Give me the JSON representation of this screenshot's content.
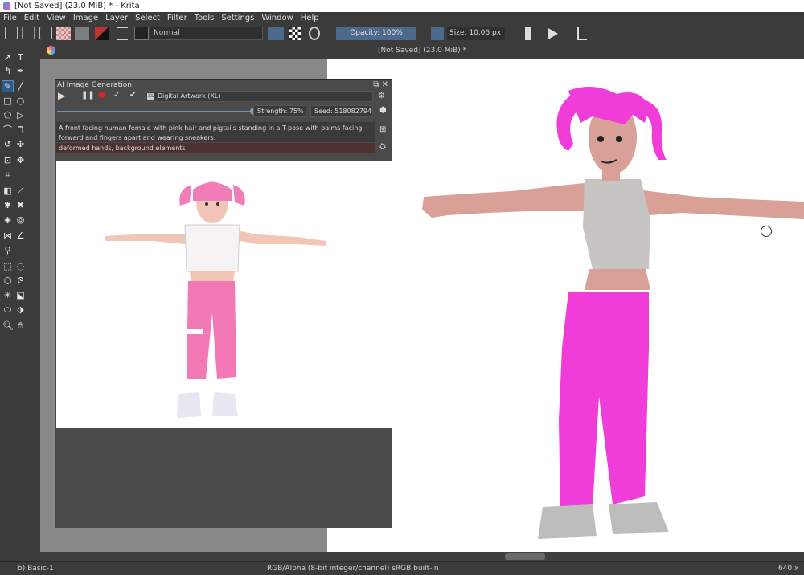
{
  "window": {
    "title": "[Not Saved]  (23.0 MiB) * - Krita"
  },
  "menu": [
    "File",
    "Edit",
    "View",
    "Image",
    "Layer",
    "Select",
    "Filter",
    "Tools",
    "Settings",
    "Window",
    "Help"
  ],
  "toolbar": {
    "blend_mode": "Normal",
    "opacity_label": "Opacity: 100%",
    "size_label": "Size: 10.06 px"
  },
  "document": {
    "tab_title": "[Not Saved]  (23.0 MiB) *"
  },
  "ai_docker": {
    "title": "AI Image Generation",
    "model": "Digital Artwork (XL)",
    "model_tag": "XL",
    "strength": "Strength: 75%",
    "seed": "Seed: 518082794",
    "prompt": "A front facing human female with pink hair and pigtails standing in a T-pose with palms facing forward and fingers apart and wearing sneakers.",
    "negative_prompt": "deformed hands, background elements",
    "strength_value": 0.75
  },
  "status": {
    "brush": "b) Basic-1",
    "color_space": "RGB/Alpha (8-bit integer/channel)  sRGB built-in",
    "dimensions": "640 x"
  },
  "colors": {
    "accent": "#4b6a8c",
    "pink": "#f03cd9",
    "skin": "#d9a098",
    "shirt": "#c9c4c4"
  }
}
